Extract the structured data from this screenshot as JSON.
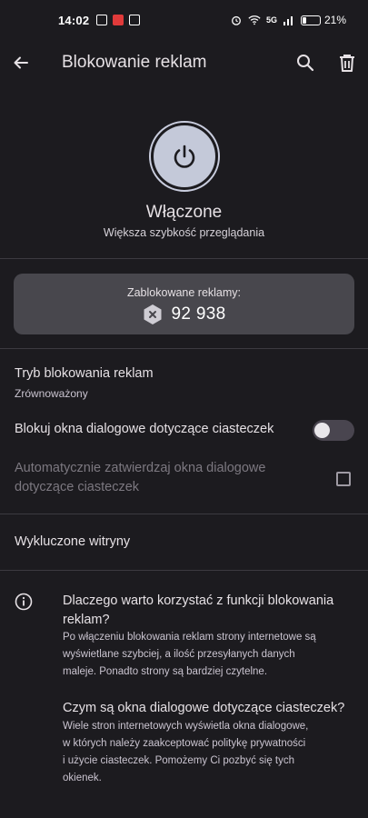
{
  "status_bar": {
    "time": "14:02",
    "network": "5G",
    "battery_text": "21%",
    "battery_level": 0.21
  },
  "app_bar": {
    "title": "Blokowanie reklam",
    "icons": [
      "back-arrow-icon",
      "search-icon",
      "trash-icon"
    ]
  },
  "hero": {
    "state": "Włączone",
    "subtitle": "Większa szybkość przeglądania"
  },
  "stats": {
    "label": "Zablokowane reklamy:",
    "value": "92 938"
  },
  "settings": {
    "mode_title": "Tryb blokowania reklam",
    "mode_value": "Zrównoważony",
    "cookie_dialogs_label": "Blokuj okna dialogowe dotyczące ciasteczek",
    "cookie_dialogs_enabled": false,
    "auto_accept_line1": "Automatycznie zatwierdzaj okna dialogowe",
    "auto_accept_line2": "dotyczące ciasteczek",
    "auto_accept_checked": false,
    "excluded_sites": "Wykluczone witryny"
  },
  "info": {
    "q1_line1": "Dlaczego warto korzystać z funkcji blokowania",
    "q1_line2": "reklam?",
    "a1_line1": "Po włączeniu blokowania reklam strony internetowe są",
    "a1_line2": "wyświetlane szybciej, a ilość przesyłanych danych",
    "a1_line3": "maleje. Ponadto strony są bardziej czytelne.",
    "q2": "Czym są okna dialogowe dotyczące ciasteczek?",
    "a2_line1": "Wiele stron internetowych wyświetla okna dialogowe,",
    "a2_line2": "w których należy zaakceptować politykę prywatności",
    "a2_line3": "i użycie ciasteczek. Pomożemy Ci pozbyć się tych",
    "a2_line4": "okienek."
  },
  "colors": {
    "background": "#1c1b1f",
    "card": "#48474d",
    "power_button": "#c4c9d9",
    "toggle_track_off": "#49454f"
  }
}
